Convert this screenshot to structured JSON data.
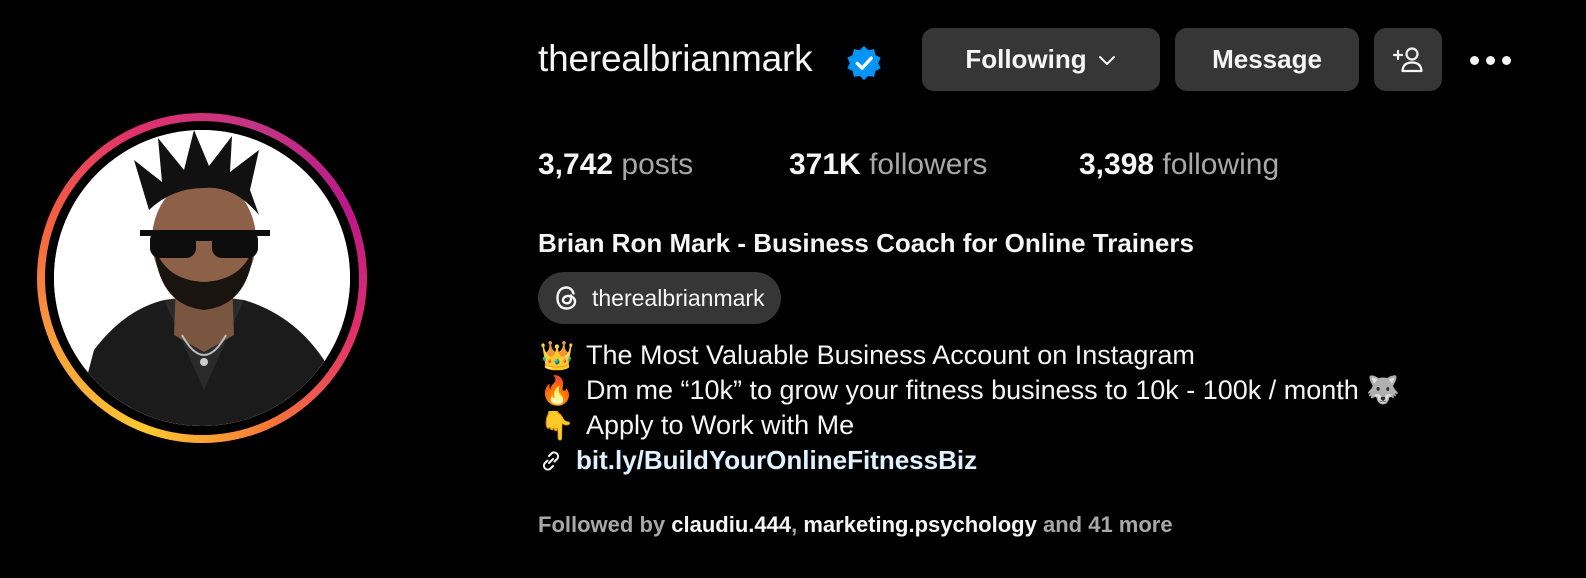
{
  "profile": {
    "username": "therealbrianmark",
    "verified_icon": "verified-badge-icon",
    "accent_color": "#0095f6"
  },
  "actions": {
    "following_label": "Following",
    "message_label": "Message",
    "add_user_icon": "add-user-icon",
    "more_icon": "more-options-icon"
  },
  "stats": {
    "posts_count": "3,742",
    "posts_label": "posts",
    "followers_count": "371K",
    "followers_label": "followers",
    "following_count": "3,398",
    "following_label": "following"
  },
  "bio": {
    "full_name": "Brian Ron Mark - Business Coach for Online Trainers",
    "threads_handle": "therealbrianmark",
    "lines": [
      {
        "emoji": "👑",
        "text": "The Most Valuable Business Account on Instagram"
      },
      {
        "emoji": "🔥",
        "text": "Dm me “10k” to grow your fitness business to 10k - 100k / month 🐺"
      },
      {
        "emoji": "👇",
        "text": "Apply to Work with Me"
      }
    ],
    "link": "bit.ly/BuildYourOnlineFitnessBiz"
  },
  "followed_by": {
    "prefix": "Followed by",
    "user1": "claudiu.444",
    "separator": ",",
    "user2": "marketing.psychology",
    "suffix": "and 41 more"
  }
}
